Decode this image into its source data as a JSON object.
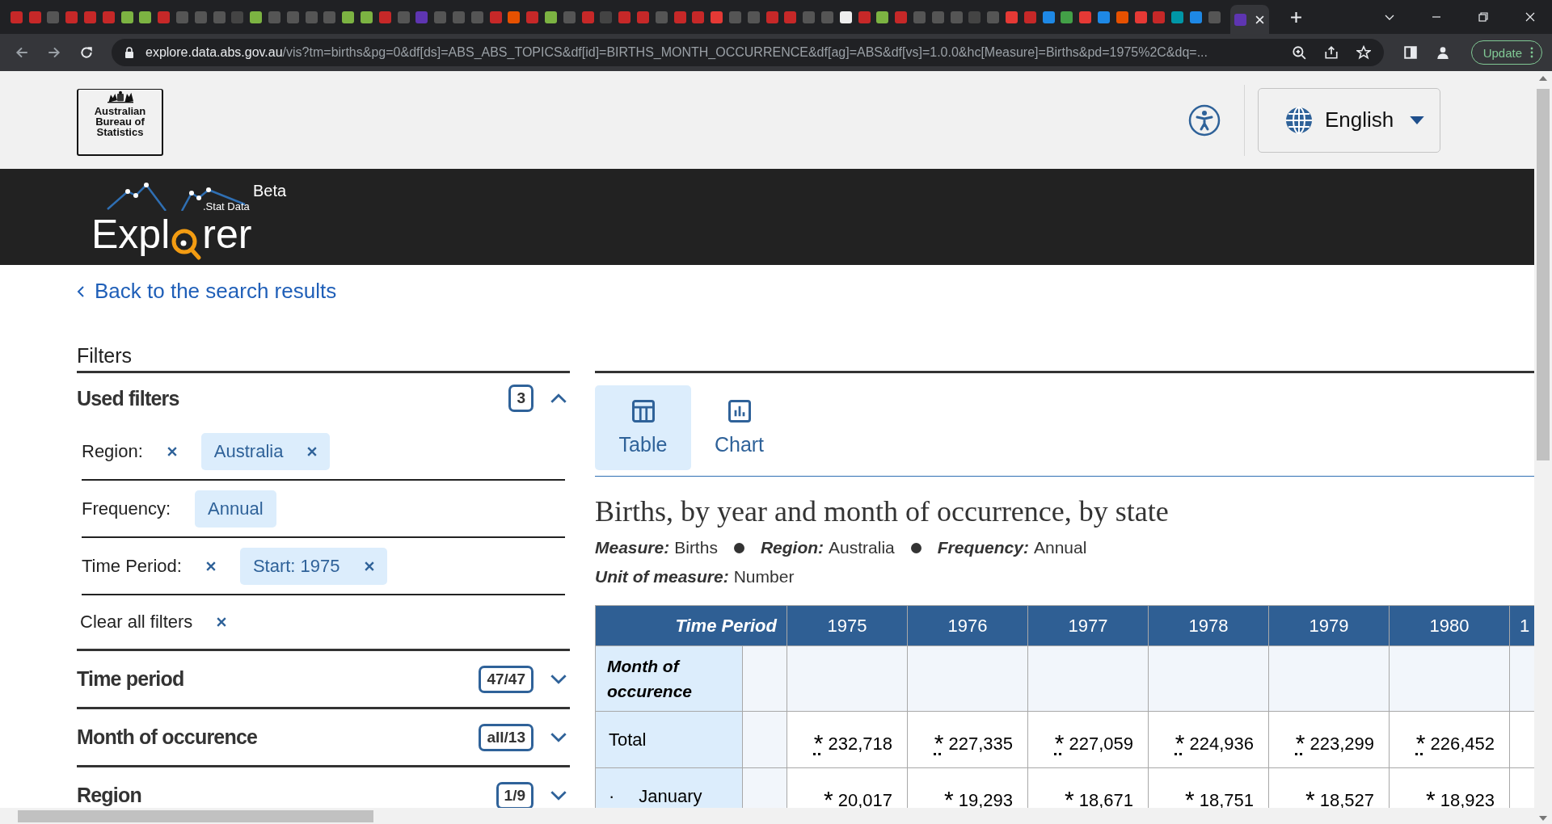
{
  "browser": {
    "url_host": "explore.data.abs.gov.au",
    "url_path": "/vis?tm=births&pg=0&df[ds]=ABS_ABS_TOPICS&df[id]=BIRTHS_MONTH_OCCURRENCE&df[ag]=ABS&df[vs]=1.0.0&hc[Measure]=Births&pd=1975%2C&dq=...",
    "update_button": "Update"
  },
  "header": {
    "logo_lines": [
      "Australian",
      "Bureau of",
      "Statistics"
    ],
    "language": "English"
  },
  "brand": {
    "name_before": "Expl",
    "name_after": "rer",
    "subtitle": ".Stat Data",
    "badge": "Beta"
  },
  "back_link": "Back to the search results",
  "filters": {
    "title": "Filters",
    "used": {
      "title": "Used filters",
      "count": "3",
      "expanded": true,
      "rows": [
        {
          "label": "Region:",
          "clearable": true,
          "chips": [
            {
              "text": "Australia",
              "removable": true
            }
          ]
        },
        {
          "label": "Frequency:",
          "clearable": false,
          "chips": [
            {
              "text": "Annual",
              "removable": false
            }
          ]
        },
        {
          "label": "Time Period:",
          "clearable": true,
          "chips": [
            {
              "text": "Start: 1975",
              "removable": true
            }
          ]
        }
      ],
      "clear_all": "Clear all filters"
    },
    "sections": [
      {
        "title": "Time period",
        "count": "47/47",
        "expanded": false
      },
      {
        "title": "Month of occurence",
        "count": "all/13",
        "expanded": false
      },
      {
        "title": "Region",
        "count": "1/9",
        "expanded": false
      }
    ]
  },
  "views": [
    {
      "label": "Table",
      "kind": "table",
      "selected": true
    },
    {
      "label": "Chart",
      "kind": "chart",
      "selected": false
    }
  ],
  "title": "Births, by year and month of occurrence, by state",
  "meta": [
    {
      "key": "Measure:",
      "value": "Births"
    },
    {
      "key": "Region:",
      "value": "Australia"
    },
    {
      "key": "Frequency:",
      "value": "Annual"
    }
  ],
  "unit": {
    "key": "Unit of measure:",
    "value": "Number"
  },
  "table": {
    "corner": "Time Period",
    "columns": [
      "1975",
      "1976",
      "1977",
      "1978",
      "1979",
      "1980",
      "1"
    ],
    "row_header": "Month of occurence",
    "rows": [
      {
        "label": "Total",
        "marker": "",
        "cells": [
          {
            "flag": "*",
            "value": "232,718"
          },
          {
            "flag": "*",
            "value": "227,335"
          },
          {
            "flag": "*",
            "value": "227,059"
          },
          {
            "flag": "*",
            "value": "224,936"
          },
          {
            "flag": "*",
            "value": "223,299"
          },
          {
            "flag": "*",
            "value": "226,452"
          }
        ]
      },
      {
        "label": "January",
        "marker": "·",
        "cells": [
          {
            "flag": "*",
            "value": "20,017"
          },
          {
            "flag": "*",
            "value": "19,293"
          },
          {
            "flag": "*",
            "value": "18,671"
          },
          {
            "flag": "*",
            "value": "18,751"
          },
          {
            "flag": "*",
            "value": "18,527"
          },
          {
            "flag": "*",
            "value": "18,923"
          }
        ]
      }
    ]
  }
}
